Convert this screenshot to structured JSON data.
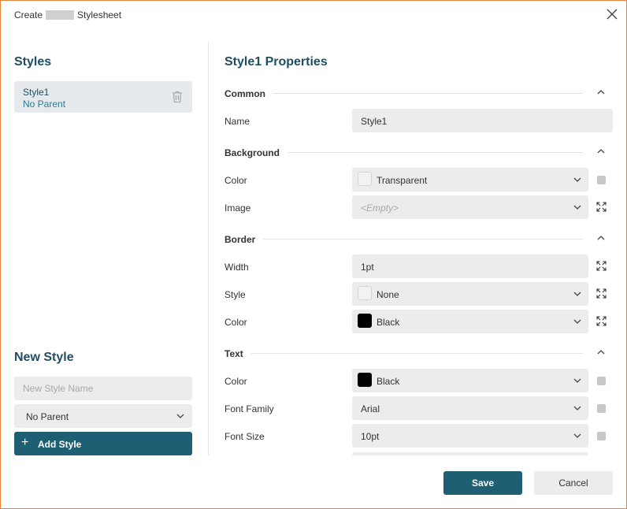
{
  "dialog": {
    "title_prefix": "Create",
    "title_suffix": "Stylesheet",
    "close_icon": "close-icon"
  },
  "styles_panel": {
    "heading": "Styles",
    "items": [
      {
        "name": "Style1",
        "parent": "No Parent",
        "delete_icon": "trash-icon"
      }
    ]
  },
  "new_style": {
    "heading": "New Style",
    "name_placeholder": "New Style Name",
    "parent_value": "No Parent",
    "add_label": "Add Style",
    "add_icon": "plus-icon"
  },
  "properties": {
    "heading": "Style1 Properties",
    "common": {
      "title": "Common",
      "name_label": "Name",
      "name_value": "Style1"
    },
    "background": {
      "title": "Background",
      "color_label": "Color",
      "color_value": "Transparent",
      "image_label": "Image",
      "image_value": "<Empty>"
    },
    "border": {
      "title": "Border",
      "width_label": "Width",
      "width_value": "1pt",
      "style_label": "Style",
      "style_value": "None",
      "color_label": "Color",
      "color_value": "Black"
    },
    "text": {
      "title": "Text",
      "color_label": "Color",
      "color_value": "Black",
      "font_family_label": "Font Family",
      "font_family_value": "Arial",
      "font_size_label": "Font Size",
      "font_size_value": "10pt"
    }
  },
  "footer": {
    "save_label": "Save",
    "cancel_label": "Cancel"
  },
  "colors": {
    "accent": "#1f5f73",
    "heading": "#1f4e63",
    "field_bg": "#ececec",
    "swatch_black": "#000000"
  }
}
